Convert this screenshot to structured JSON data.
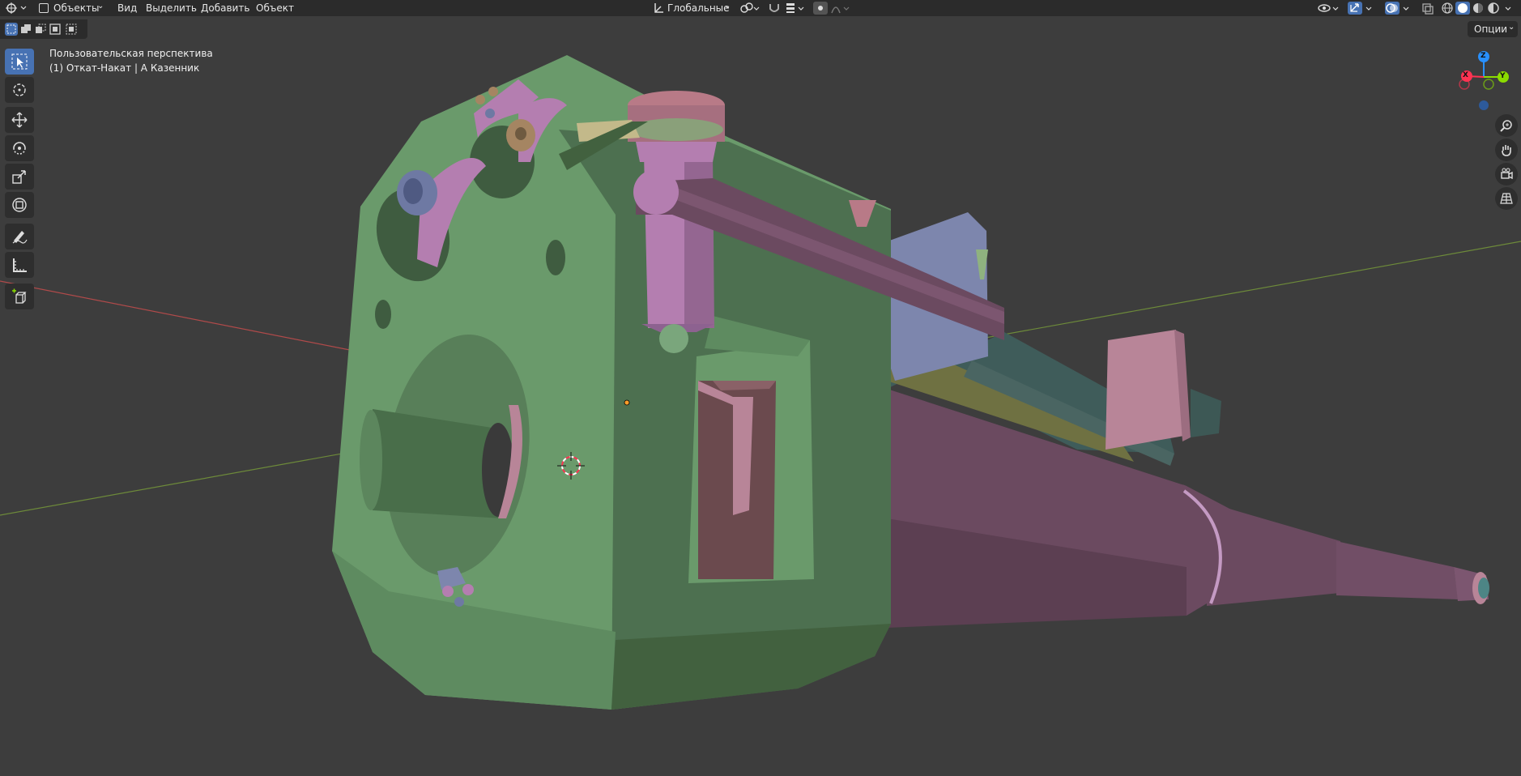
{
  "header": {
    "mode_label": "Объекты",
    "menu": [
      "Вид",
      "Выделить",
      "Добавить",
      "Объект"
    ],
    "transform_orientation": "Глобальные"
  },
  "viewport": {
    "view_name": "Пользовательская перспектива",
    "collection_info": "(1) Откат-Накат | А Казенник",
    "options_label": "Опции",
    "gizmo_axes": [
      "X",
      "Y",
      "Z"
    ]
  },
  "toolbar": {
    "tools": [
      "select-box",
      "cursor",
      "move",
      "rotate",
      "scale",
      "transform",
      "annotate",
      "measure",
      "add-cube"
    ]
  },
  "navigation": {
    "buttons": [
      "zoom",
      "pan",
      "camera",
      "ortho-grid"
    ]
  },
  "colors": {
    "header_bg": "#2b2b2b",
    "viewport_bg": "#3d3d3d",
    "active_tool": "#4772b3",
    "axis_x": "#ff3352",
    "axis_y": "#8bdc00",
    "axis_z": "#2890ff",
    "model_green": "#6a9a6b",
    "model_purple": "#6b4a60",
    "model_pink": "#b88598",
    "model_blue": "#7d86ad",
    "model_olive": "#6f7142",
    "model_teal": "#3f5c5a"
  }
}
